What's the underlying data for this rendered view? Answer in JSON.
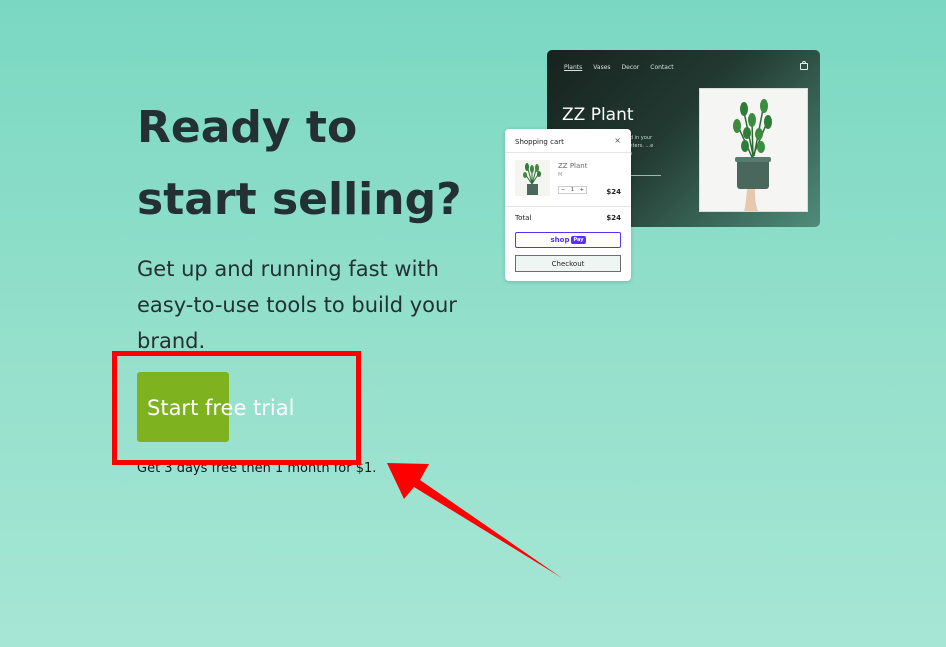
{
  "hero": {
    "title": "Ready to start selling?",
    "subtitle": "Get up and running fast with easy-to-use tools to build your brand.",
    "cta_label": "Start free trial",
    "cta_note": "Get 3 days free then 1 month for $1."
  },
  "store_preview": {
    "nav": [
      "Plants",
      "Vases",
      "Decor",
      "Contact"
    ],
    "title": "ZZ Plant",
    "description": "...ated in your ...planters. ...e plants"
  },
  "cart": {
    "title": "Shopping cart",
    "item_name": "ZZ Plant",
    "item_variant": "M",
    "quantity": "1",
    "item_price": "$24",
    "total_label": "Total",
    "total": "$24",
    "shop_pay_label": "shop",
    "shop_pay_badge": "Pay",
    "checkout_label": "Checkout"
  },
  "annotation": {
    "highlight_color": "#ff0000",
    "arrow_color": "#ff0000"
  },
  "colors": {
    "cta_background": "#7fb21f",
    "page_background": "#7ad8c2"
  }
}
